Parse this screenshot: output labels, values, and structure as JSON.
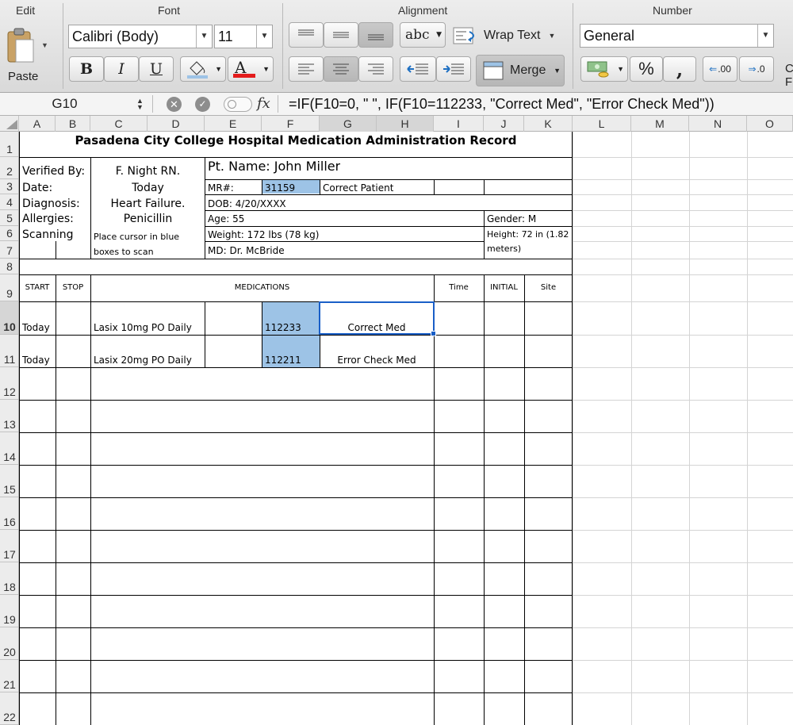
{
  "ribbon": {
    "groups": {
      "edit": "Edit",
      "font": "Font",
      "alignment": "Alignment",
      "number": "Number"
    },
    "paste_label": "Paste",
    "font_name": "Calibri (Body)",
    "font_size": "11",
    "bold": "B",
    "italic": "I",
    "underline": "U",
    "font_color_glyph": "A",
    "abc_label": "abc",
    "wrap_text_label": "Wrap Text",
    "merge_label": "Merge",
    "number_format": "General",
    "percent_label": "%",
    "comma_label": ",",
    "inc_decimal_label": ".00",
    "dec_decimal_label": ".0",
    "cut_off_text": "C F",
    "colors": {
      "fill_bar": "#9dc3e6",
      "font_color_bar": "#e31b1b"
    }
  },
  "formula_bar": {
    "name_box": "G10",
    "fx_label": "fx",
    "formula": "=IF(F10=0, \" \", IF(F10=112233, \"Correct Med\", \"Error Check Med\"))"
  },
  "sheet": {
    "columns": [
      "A",
      "B",
      "C",
      "D",
      "E",
      "F",
      "G",
      "H",
      "I",
      "J",
      "K",
      "L",
      "M",
      "N",
      "O"
    ],
    "selected_columns": [
      "G",
      "H"
    ],
    "rows": [
      "1",
      "2",
      "3",
      "4",
      "5",
      "6",
      "7",
      "8",
      "9",
      "10",
      "11",
      "12",
      "13",
      "14",
      "15",
      "16",
      "17",
      "18",
      "19",
      "20",
      "21",
      "22"
    ],
    "selected_row": "10",
    "title": "Pasadena City College Hospital Medication Administration Record",
    "verified_label": "Verified By:",
    "verified_value": "F. Night RN.",
    "date_label": "Date:",
    "date_value": "Today",
    "diagnosis_label": "Diagnosis:",
    "diagnosis_value": "Heart Failure.",
    "allergies_label": "Allergies:",
    "allergies_value": "Penicillin",
    "scanning_label": "Scanning",
    "scan_note_1": "Place cursor in blue",
    "scan_note_2": "boxes to scan",
    "pt_name": "Pt. Name: John Miller",
    "mr_label": "MR#:",
    "mr_value": "31159",
    "mr_status": "Correct Patient",
    "dob": "DOB: 4/20/XXXX",
    "age": "Age: 55",
    "gender": "Gender: M",
    "weight": "Weight: 172 lbs (78 kg)",
    "height_1": "Height: 72 in (1.82",
    "height_2": "meters)",
    "md": "MD: Dr.  McBride",
    "headers": {
      "start": "START",
      "stop": "STOP",
      "medications": "MEDICATIONS",
      "time": "Time",
      "initial": "INITIAL",
      "site": "Site"
    },
    "med_rows": [
      {
        "start": "Today",
        "medication": "Lasix 10mg PO Daily",
        "scan": "112233",
        "result": "Correct Med"
      },
      {
        "start": "Today",
        "medication": "Lasix 20mg PO Daily",
        "scan": "112211",
        "result": "Error Check Med"
      }
    ]
  }
}
